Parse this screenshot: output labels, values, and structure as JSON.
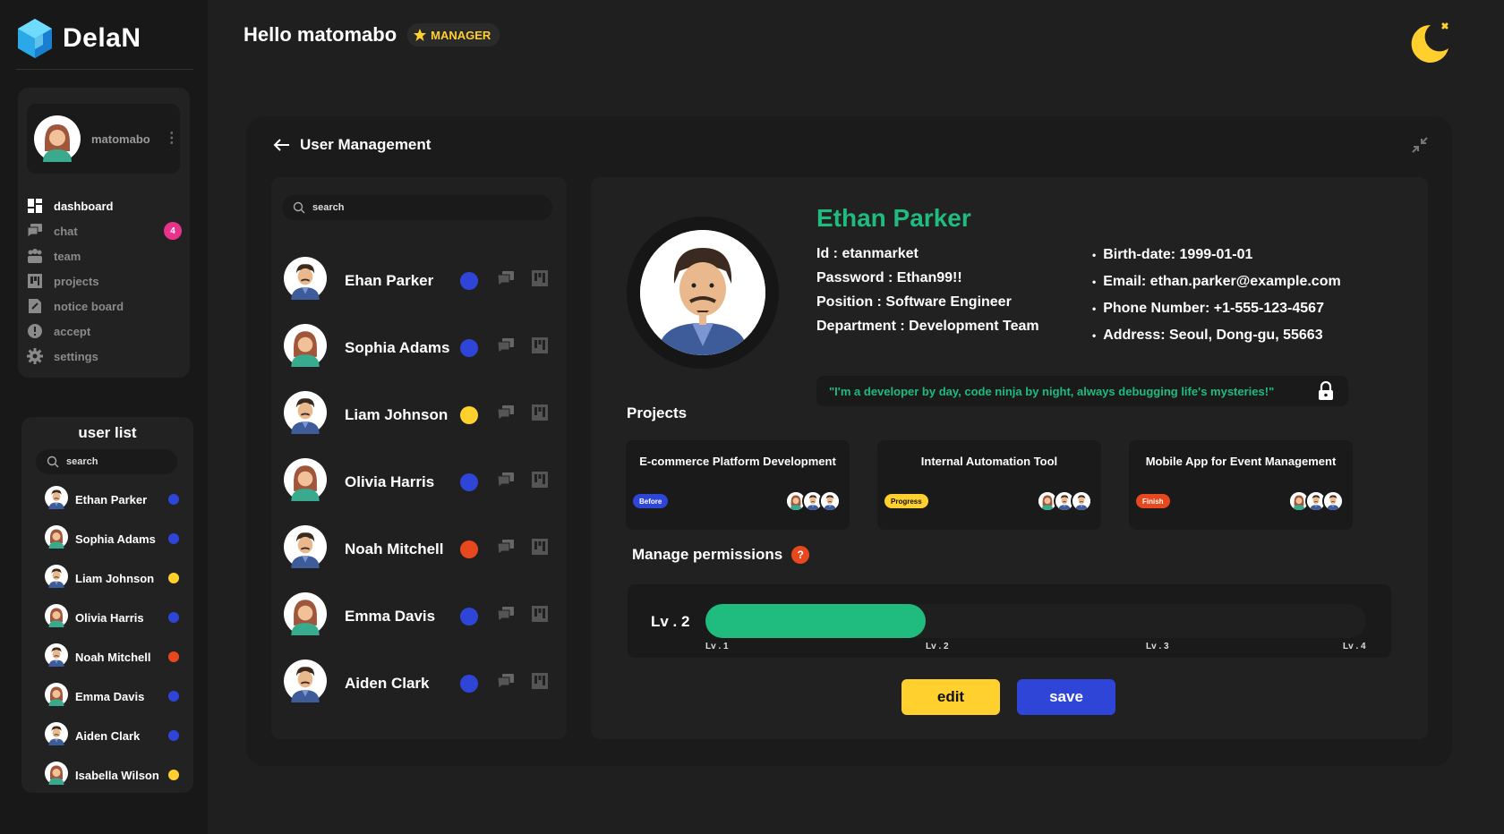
{
  "app": {
    "name": "DelaN"
  },
  "colors": {
    "accent_green": "#1fbb7f",
    "blue": "#2f45d8",
    "yellow": "#ffd02e",
    "orange": "#e8481e",
    "pink": "#e9338a"
  },
  "sidebar": {
    "profile": {
      "username": "matomabo"
    },
    "nav": [
      {
        "label": "dashboard",
        "icon": "dashboard-icon",
        "active": true
      },
      {
        "label": "chat",
        "icon": "chat-icon",
        "badge": "4"
      },
      {
        "label": "team",
        "icon": "team-icon"
      },
      {
        "label": "projects",
        "icon": "projects-icon"
      },
      {
        "label": "notice board",
        "icon": "notice-board-icon"
      },
      {
        "label": "accept",
        "icon": "accept-icon"
      },
      {
        "label": "settings",
        "icon": "gear-icon"
      }
    ],
    "user_list": {
      "title": "user list",
      "search_placeholder": "search",
      "users": [
        {
          "name": "Ethan Parker",
          "gender": "m",
          "status": "#2f45d8"
        },
        {
          "name": "Sophia Adams",
          "gender": "f",
          "status": "#2f45d8"
        },
        {
          "name": "Liam Johnson",
          "gender": "m",
          "status": "#ffd02e"
        },
        {
          "name": "Olivia Harris",
          "gender": "f",
          "status": "#2f45d8"
        },
        {
          "name": "Noah Mitchell",
          "gender": "m",
          "status": "#e8481e"
        },
        {
          "name": "Emma Davis",
          "gender": "f",
          "status": "#2f45d8"
        },
        {
          "name": "Aiden Clark",
          "gender": "m",
          "status": "#2f45d8"
        },
        {
          "name": "Isabella Wilson",
          "gender": "f",
          "status": "#ffd02e"
        }
      ]
    }
  },
  "header": {
    "greeting": "Hello matomabo",
    "role_badge": "MANAGER"
  },
  "panel": {
    "title": "User Management",
    "search_placeholder": "search",
    "users": [
      {
        "name": "Ehan Parker",
        "gender": "m",
        "status": "#2f45d8"
      },
      {
        "name": "Sophia Adams",
        "gender": "f",
        "status": "#2f45d8"
      },
      {
        "name": "Liam Johnson",
        "gender": "m",
        "status": "#ffd02e"
      },
      {
        "name": "Olivia Harris",
        "gender": "f",
        "status": "#2f45d8"
      },
      {
        "name": "Noah Mitchell",
        "gender": "m",
        "status": "#e8481e"
      },
      {
        "name": "Emma Davis",
        "gender": "f",
        "status": "#2f45d8"
      },
      {
        "name": "Aiden Clark",
        "gender": "m",
        "status": "#2f45d8"
      }
    ]
  },
  "detail": {
    "name": "Ethan Parker",
    "id_line": "Id : etanmarket",
    "password_line": "Password : Ethan99!!",
    "position_line": "Position : Software Engineer",
    "department_line": "Department : Development Team",
    "birth_line": "Birth-date: 1999-01-01",
    "email_line": "Email: ethan.parker@example.com",
    "phone_line": "Phone Number: +1-555-123-4567",
    "address_line": "Address: Seoul, Dong-gu, 55663",
    "quote": "\"I'm a developer by day, code ninja by night, always debugging life's mysteries!\"",
    "projects_title": "Projects",
    "projects": [
      {
        "name": "E-commerce Platform Development",
        "status": "Before",
        "status_color": "#2f45d8",
        "status_text_color": "#ffffff"
      },
      {
        "name": "Internal Automation Tool",
        "status": "Progress",
        "status_color": "#ffd02e",
        "status_text_color": "#111111"
      },
      {
        "name": "Mobile App for Event Management",
        "status": "Finish",
        "status_color": "#e8481e",
        "status_text_color": "#ffffff"
      }
    ],
    "permissions_title": "Manage permissions",
    "permissions_help": "?",
    "level": {
      "current_label": "Lv . 2",
      "value": 2,
      "max": 4,
      "ticks": [
        "Lv . 1",
        "Lv . 2",
        "Lv . 3",
        "Lv . 4"
      ]
    },
    "edit_label": "edit",
    "save_label": "save"
  }
}
